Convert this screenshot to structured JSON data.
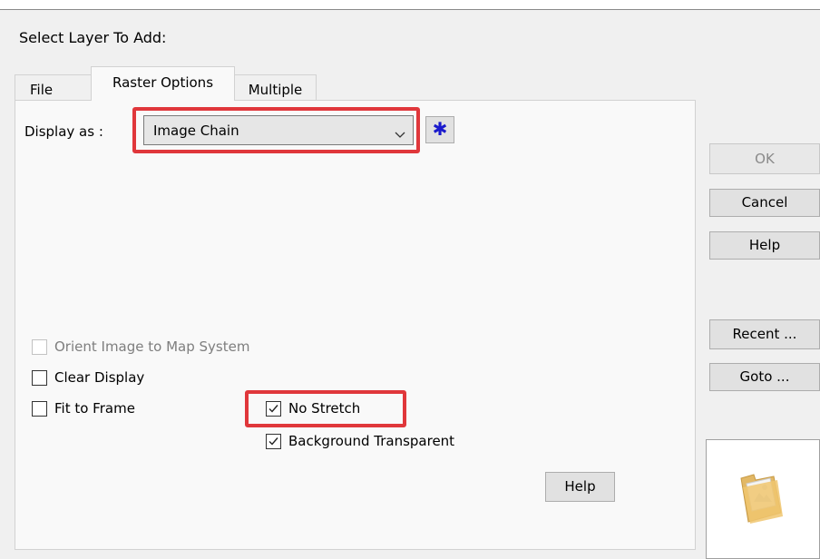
{
  "dialog": {
    "title": "Select Layer To Add:"
  },
  "tabs": [
    {
      "label": "File",
      "selected": false
    },
    {
      "label": "Raster Options",
      "selected": true
    },
    {
      "label": "Multiple",
      "selected": false
    }
  ],
  "raster": {
    "display_as_label": "Display as :",
    "display_as_value": "Image Chain",
    "star_button_icon": "asterisk-icon",
    "checkboxes": {
      "orient": {
        "label": "Orient Image to Map System",
        "checked": false,
        "enabled": false
      },
      "clear_display": {
        "label": "Clear Display",
        "checked": false,
        "enabled": true
      },
      "fit_to_frame": {
        "label": "Fit to Frame",
        "checked": false,
        "enabled": true
      },
      "no_stretch": {
        "label": "No Stretch",
        "checked": true,
        "enabled": true
      },
      "background_transparent": {
        "label": "Background Transparent",
        "checked": true,
        "enabled": true
      }
    },
    "help_button": "Help"
  },
  "buttons": {
    "ok": "OK",
    "cancel": "Cancel",
    "help": "Help",
    "recent": "Recent ...",
    "goto": "Goto ..."
  },
  "preview": {
    "icon": "folder-image-icon"
  },
  "colors": {
    "highlight_box": "#e0373b",
    "star_icon": "#1a1acc"
  }
}
